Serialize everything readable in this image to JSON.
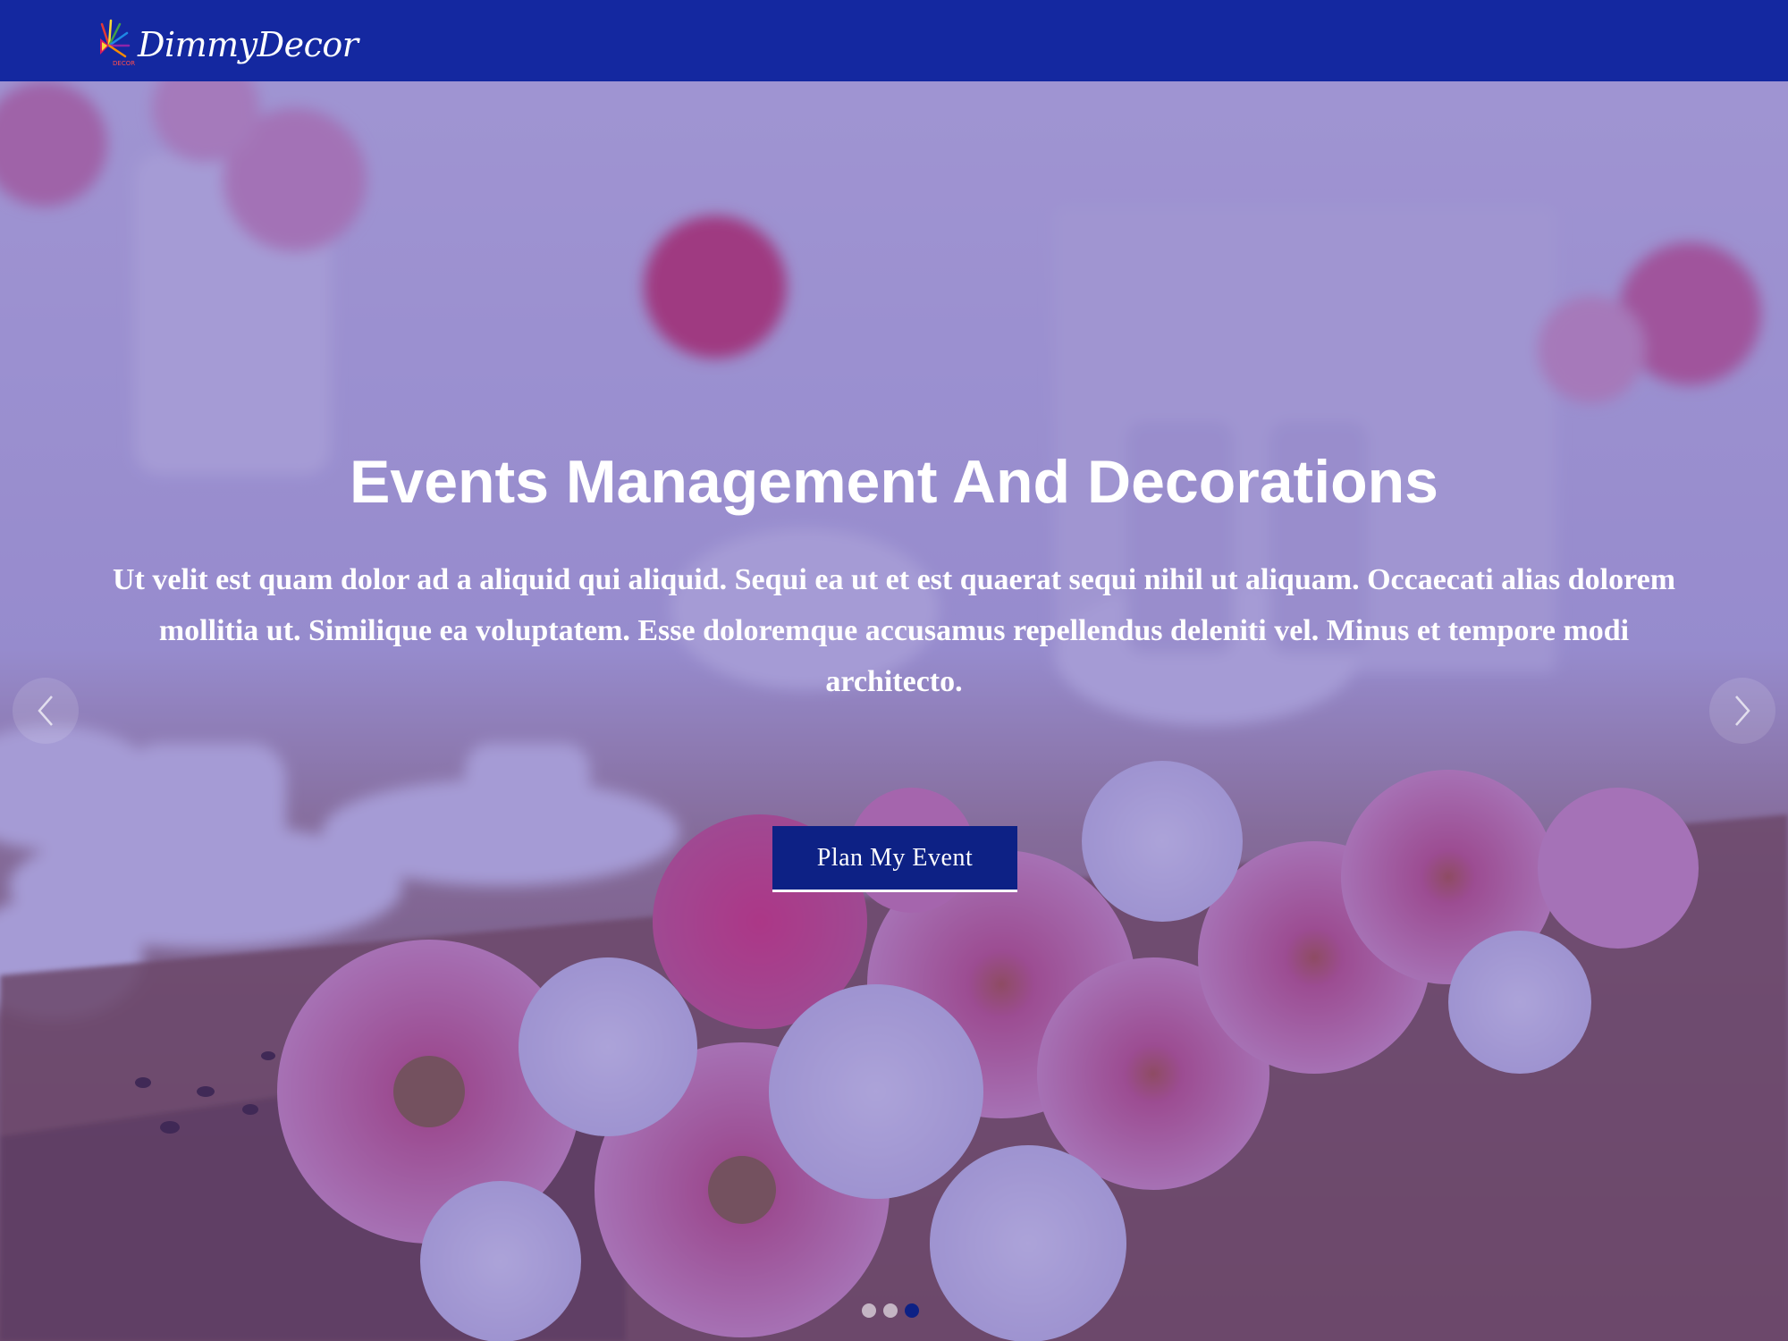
{
  "header": {
    "brand": "DimmyDecor",
    "logo_mark_text": "DECOR"
  },
  "hero": {
    "title": "Events Management And Decorations",
    "description": "Ut velit est quam dolor ad a aliquid qui aliquid. Sequi ea ut et est quaerat sequi nihil ut aliquam. Occaecati alias dolorem mollitia ut. Similique ea voluptatem. Esse doloremque accusamus repellendus deleniti vel. Minus et tempore modi architecto.",
    "cta_label": "Plan My Event"
  },
  "carousel": {
    "prev_icon": "chevron-left-icon",
    "next_icon": "chevron-right-icon",
    "slide_count": 3,
    "active_index": 2
  },
  "colors": {
    "header_bg": "#1428a0",
    "button_bg": "#0d2185",
    "overlay": "rgba(70,50,170,0.45)"
  }
}
